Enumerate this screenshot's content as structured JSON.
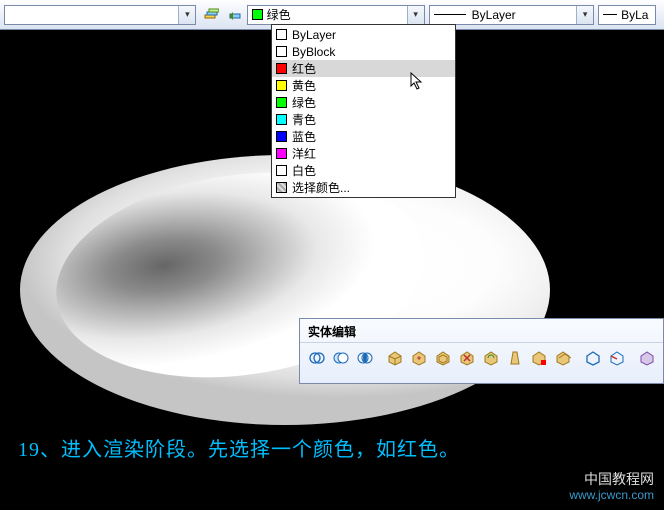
{
  "toolbar": {
    "layer_combo": {
      "value": ""
    },
    "color_combo": {
      "value": "绿色",
      "swatch": "#00ff00"
    },
    "linetype_combo": {
      "value": "ByLayer"
    },
    "lineweight_combo": {
      "value": "ByLa"
    }
  },
  "color_dropdown": [
    {
      "swatch": "#ffffff",
      "label": "ByLayer"
    },
    {
      "swatch": "#ffffff",
      "label": "ByBlock"
    },
    {
      "swatch": "#ff0000",
      "label": "红色",
      "hi": true
    },
    {
      "swatch": "#ffff00",
      "label": "黄色"
    },
    {
      "swatch": "#00ff00",
      "label": "绿色"
    },
    {
      "swatch": "#00ffff",
      "label": "青色"
    },
    {
      "swatch": "#0000ff",
      "label": "蓝色"
    },
    {
      "swatch": "#ff00ff",
      "label": "洋红"
    },
    {
      "swatch": "#ffffff",
      "label": "白色"
    },
    {
      "swatch": "#c0c0c0",
      "label": "选择颜色..."
    }
  ],
  "panel": {
    "title": "实体编辑"
  },
  "caption": "19、进入渲染阶段。先选择一个颜色，如红色。",
  "watermark": {
    "cn": "中国教程网",
    "url": "www.jcwcn.com"
  },
  "icons": {
    "layer_props": "layer-properties-icon",
    "layer_prev": "layer-previous-icon"
  }
}
